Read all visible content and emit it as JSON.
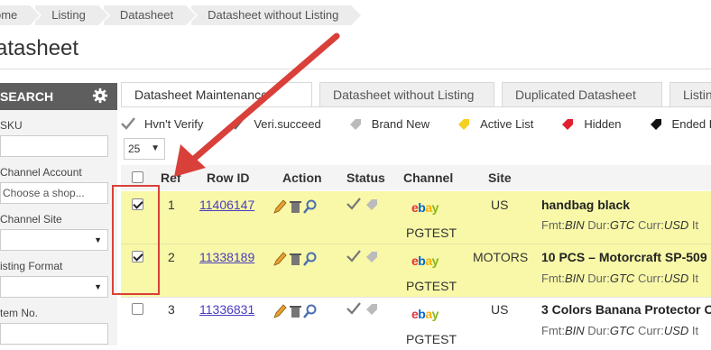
{
  "breadcrumb": [
    "ome",
    "Listing",
    "Datasheet",
    "Datasheet without Listing"
  ],
  "page_title": "atasheet",
  "sidebar": {
    "header": "SEARCH",
    "sku_label": "SKU",
    "channel_account_label": "Channel Account",
    "channel_account_placeholder": "Choose a shop...",
    "channel_site_label": "Channel Site",
    "listing_format_label": "isting Format",
    "item_no_label": "tem No."
  },
  "tabs": [
    "Datasheet Maintenance",
    "Datasheet without Listing",
    "Duplicated Datasheet",
    "Listing"
  ],
  "legend": [
    "Hvn't Verify",
    "Veri.succeed",
    "Brand New",
    "Active List",
    "Hidden",
    "Ended L"
  ],
  "page_size": "25",
  "columns": [
    "Ref",
    "Row ID",
    "Action",
    "Status",
    "Channel",
    "Site"
  ],
  "rows": [
    {
      "ref": "1",
      "row_id": "11406147",
      "channel": "PGTEST",
      "site": "US",
      "title": "handbag black",
      "checked": true,
      "fmt": "BIN",
      "dur": "GTC",
      "curr": "USD"
    },
    {
      "ref": "2",
      "row_id": "11338189",
      "channel": "PGTEST",
      "site": "MOTORS",
      "title": "10 PCS – Motorcraft SP-509",
      "checked": true,
      "fmt": "BIN",
      "dur": "GTC",
      "curr": "USD"
    },
    {
      "ref": "3",
      "row_id": "11336831",
      "channel": "PGTEST",
      "site": "US",
      "title": "3 Colors Banana Protector C",
      "checked": false,
      "fmt": "BIN",
      "dur": "GTC",
      "curr": "USD"
    }
  ],
  "meta_labels": {
    "fmt": "Fmt:",
    "dur": "Dur:",
    "curr": "Curr:",
    "tail": "It"
  },
  "ebay_logo": {
    "e": "e",
    "b": "b",
    "a": "a",
    "y": "y"
  },
  "colors": {
    "highlight": "#f8f8a8",
    "annotation": "#d9403a",
    "link": "#4a3dbd"
  }
}
